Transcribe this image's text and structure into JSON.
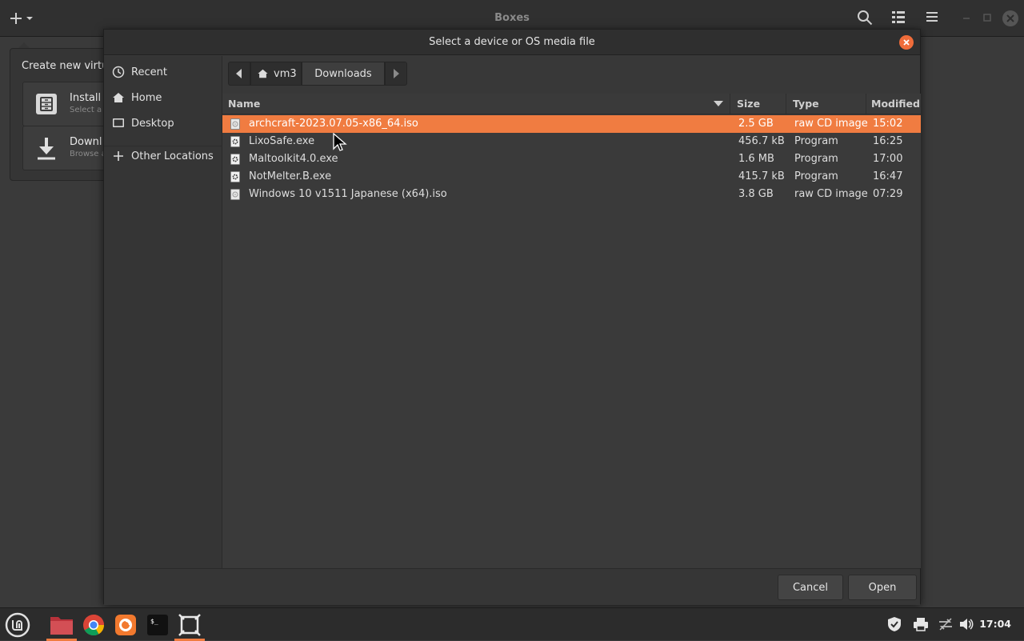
{
  "app": {
    "title": "Boxes",
    "header_icons": [
      "add-icon",
      "dropdown-icon",
      "search-icon",
      "list-view-icon",
      "menu-icon",
      "minimize-icon",
      "maximize-icon",
      "close-icon"
    ]
  },
  "popover": {
    "title": "Create new virtu",
    "items": [
      {
        "label": "Install",
        "sub": "Select a",
        "icon": "installer-icon"
      },
      {
        "label": "Downl",
        "sub": "Browse a",
        "icon": "download-icon"
      }
    ]
  },
  "dialog": {
    "title": "Select a device or OS media file",
    "sidebar": [
      {
        "label": "Recent",
        "icon": "recent-icon"
      },
      {
        "label": "Home",
        "icon": "home-icon"
      },
      {
        "label": "Desktop",
        "icon": "desktop-icon"
      },
      {
        "label": "Other Locations",
        "icon": "plus-icon"
      }
    ],
    "pathbar": {
      "segments": [
        "vm3",
        "Downloads"
      ],
      "active": "Downloads"
    },
    "columns": {
      "name": "Name",
      "size": "Size",
      "type": "Type",
      "modified": "Modified"
    },
    "files": [
      {
        "name": "archcraft-2023.07.05-x86_64.iso",
        "size": "2.5 GB",
        "type": "raw CD image",
        "modified": "15:02",
        "selected": true,
        "icon": "disc-file-icon"
      },
      {
        "name": "LixoSafe.exe",
        "size": "456.7 kB",
        "type": "Program",
        "modified": "16:25",
        "selected": false,
        "icon": "executable-icon"
      },
      {
        "name": "Maltoolkit4.0.exe",
        "size": "1.6 MB",
        "type": "Program",
        "modified": "17:00",
        "selected": false,
        "icon": "executable-icon"
      },
      {
        "name": "NotMelter.B.exe",
        "size": "415.7 kB",
        "type": "Program",
        "modified": "16:47",
        "selected": false,
        "icon": "executable-icon"
      },
      {
        "name": "Windows 10 v1511 Japanese (x64).iso",
        "size": "3.8 GB",
        "type": "raw CD image",
        "modified": "07:29",
        "selected": false,
        "icon": "disc-file-icon"
      }
    ],
    "buttons": {
      "cancel": "Cancel",
      "open": "Open"
    }
  },
  "taskbar": {
    "apps": [
      "mint-menu-icon",
      "files-icon",
      "chrome-icon",
      "firefox-icon",
      "terminal-icon",
      "boxes-icon"
    ],
    "tray": [
      "shield-icon",
      "printer-icon",
      "network-icon",
      "volume-icon"
    ],
    "clock": "17:04"
  },
  "colors": {
    "accent": "#f07c41",
    "close": "#ef6c3a"
  }
}
